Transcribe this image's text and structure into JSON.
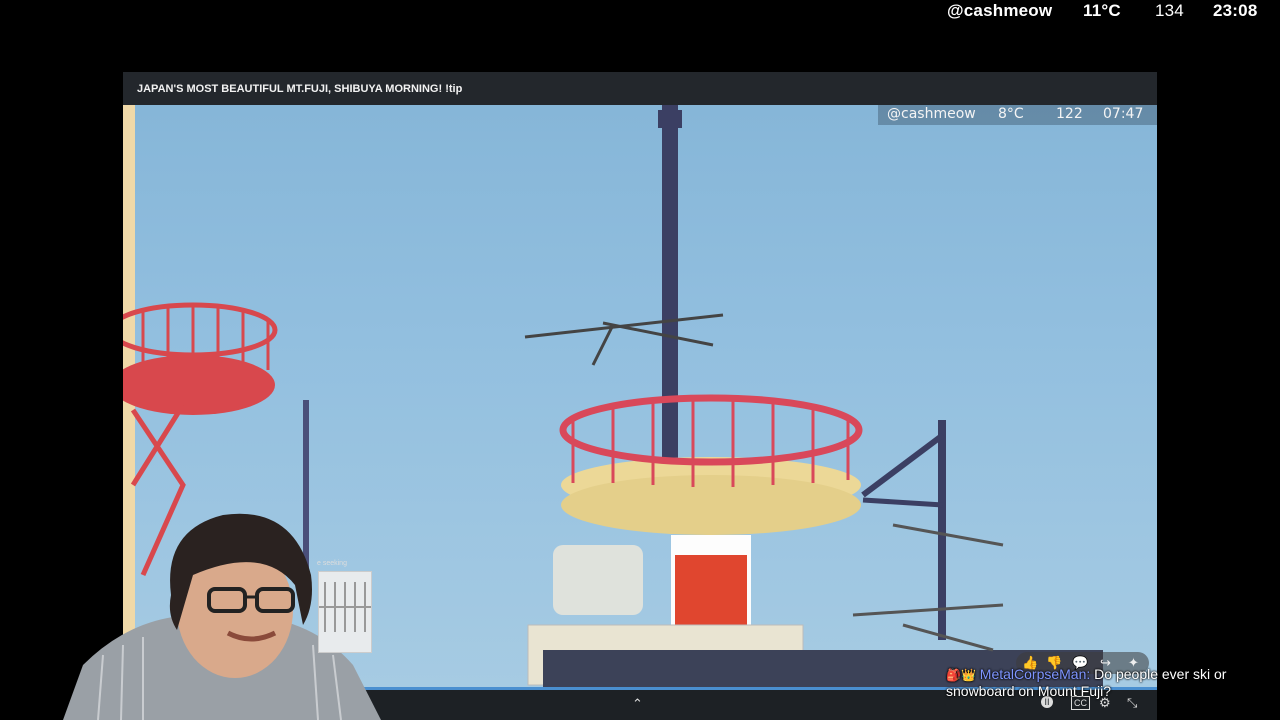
{
  "status_bar": {
    "username": "@cashmeow",
    "temperature": "11°C",
    "count": "134",
    "time": "23:08"
  },
  "window": {
    "title": "JAPAN'S MOST BEAUTIFUL MT.FUJI, SHIBUYA MORNING! !tip"
  },
  "video_overlay": {
    "username": "@cashmeow",
    "temperature": "8°C",
    "count": "122",
    "time": "07:47"
  },
  "webcam": {
    "thumbnail_label": "e seeking"
  },
  "controls": {
    "expand": "⌃",
    "captions": "CC",
    "settings": "⚙",
    "fullscreen_exit": "⤡"
  },
  "reactions": {
    "like": "👍",
    "dislike": "👎",
    "comment": "💬",
    "share": "↪",
    "more": "✦"
  },
  "chat": {
    "badges": "🎒👑",
    "username": "MetalCorpseMan:",
    "message": "Do people ever ski or snowboard on Mount Fuji?"
  },
  "colors": {
    "sky": "#8fbcdc",
    "tower_red": "#d94d52",
    "tower_yellow": "#e8cf8a",
    "chat_user": "#7e95ff"
  }
}
